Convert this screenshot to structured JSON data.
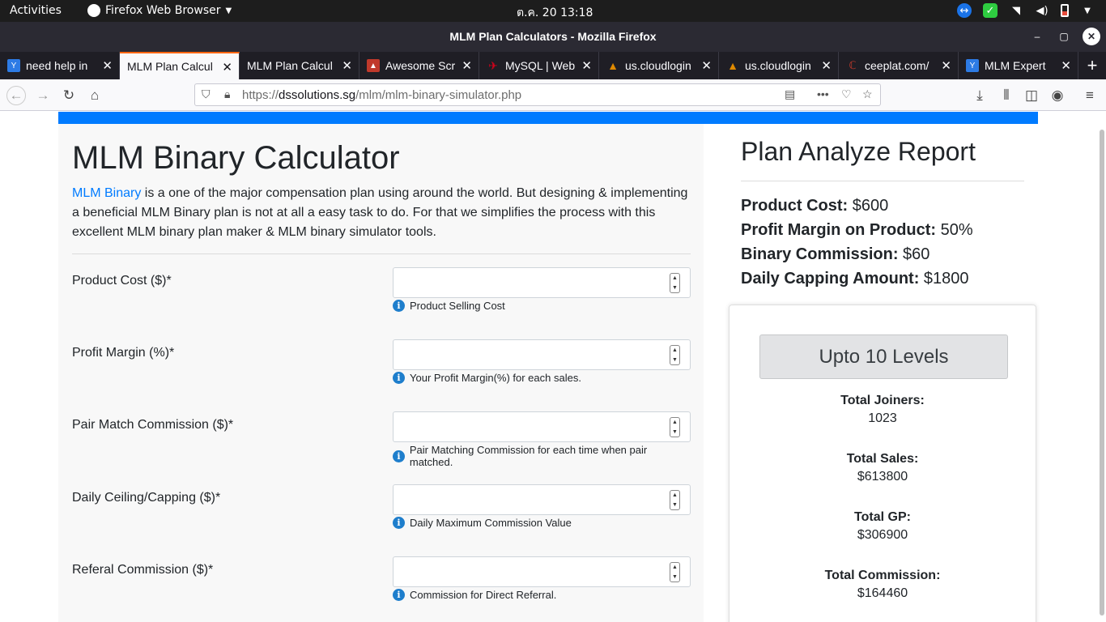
{
  "os": {
    "activities": "Activities",
    "app_menu": "Firefox Web Browser",
    "clock": "ต.ค. 20  13:18"
  },
  "window": {
    "title": "MLM Plan Calculators - Mozilla Firefox"
  },
  "tabs": [
    {
      "label": "need help in ",
      "favicon_color": "#2d7be5"
    },
    {
      "label": "MLM Plan Calcul",
      "favicon_color": "",
      "active": true
    },
    {
      "label": "MLM Plan Calcul",
      "favicon_color": ""
    },
    {
      "label": "Awesome Scr",
      "favicon_color": "#c0392b"
    },
    {
      "label": "MySQL | Web",
      "favicon_color": "#d0021b"
    },
    {
      "label": "us.cloudlogin",
      "favicon_color": "#e08a00"
    },
    {
      "label": "us.cloudlogin",
      "favicon_color": "#e08a00"
    },
    {
      "label": "ceeplat.com/",
      "favicon_color": "#c0392b"
    },
    {
      "label": "MLM Expert",
      "favicon_color": "#2d7be5"
    }
  ],
  "nav": {
    "url_prefix": "https://",
    "url_domain": "dssolutions.sg",
    "url_path": "/mlm/mlm-binary-simulator.php"
  },
  "page": {
    "heading": "MLM Binary Calculator",
    "intro_link": "MLM Binary",
    "intro_text": " is a one of the major compensation plan using around the world. But designing & implementing a beneficial MLM Binary plan is not at all a easy task to do. For that we simplifies the process with this excellent MLM binary plan maker & MLM binary simulator tools.",
    "fields": [
      {
        "label": "Product Cost ($)*",
        "help": "Product Selling Cost"
      },
      {
        "label": "Profit Margin (%)*",
        "help": "Your Profit Margin(%) for each sales."
      },
      {
        "label": "Pair Match Commission ($)*",
        "help": "Pair Matching Commission for each time when pair matched."
      },
      {
        "label": "Daily Ceiling/Capping ($)*",
        "help": "Daily Maximum Commission Value"
      },
      {
        "label": "Referal Commission ($)*",
        "help": "Commission for Direct Referral."
      }
    ]
  },
  "report": {
    "title": "Plan Analyze Report",
    "product_cost_label": "Product Cost:",
    "product_cost_value": " $600",
    "profit_margin_label": "Profit Margin on Product:",
    "profit_margin_value": " 50%",
    "binary_commission_label": "Binary Commission:",
    "binary_commission_value": " $60",
    "daily_capping_label": "Daily Capping Amount:",
    "daily_capping_value": " $1800",
    "level_button": "Upto 10 Levels",
    "stats": [
      {
        "label": "Total Joiners:",
        "value": "1023"
      },
      {
        "label": "Total Sales:",
        "value": "$613800"
      },
      {
        "label": "Total GP:",
        "value": "$306900"
      },
      {
        "label": "Total Commission:",
        "value": "$164460"
      }
    ]
  },
  "colors": {
    "accent_blue": "#007bff",
    "firefox_dark": "#2b2a33",
    "active_tab_marker": "#ff6611"
  }
}
